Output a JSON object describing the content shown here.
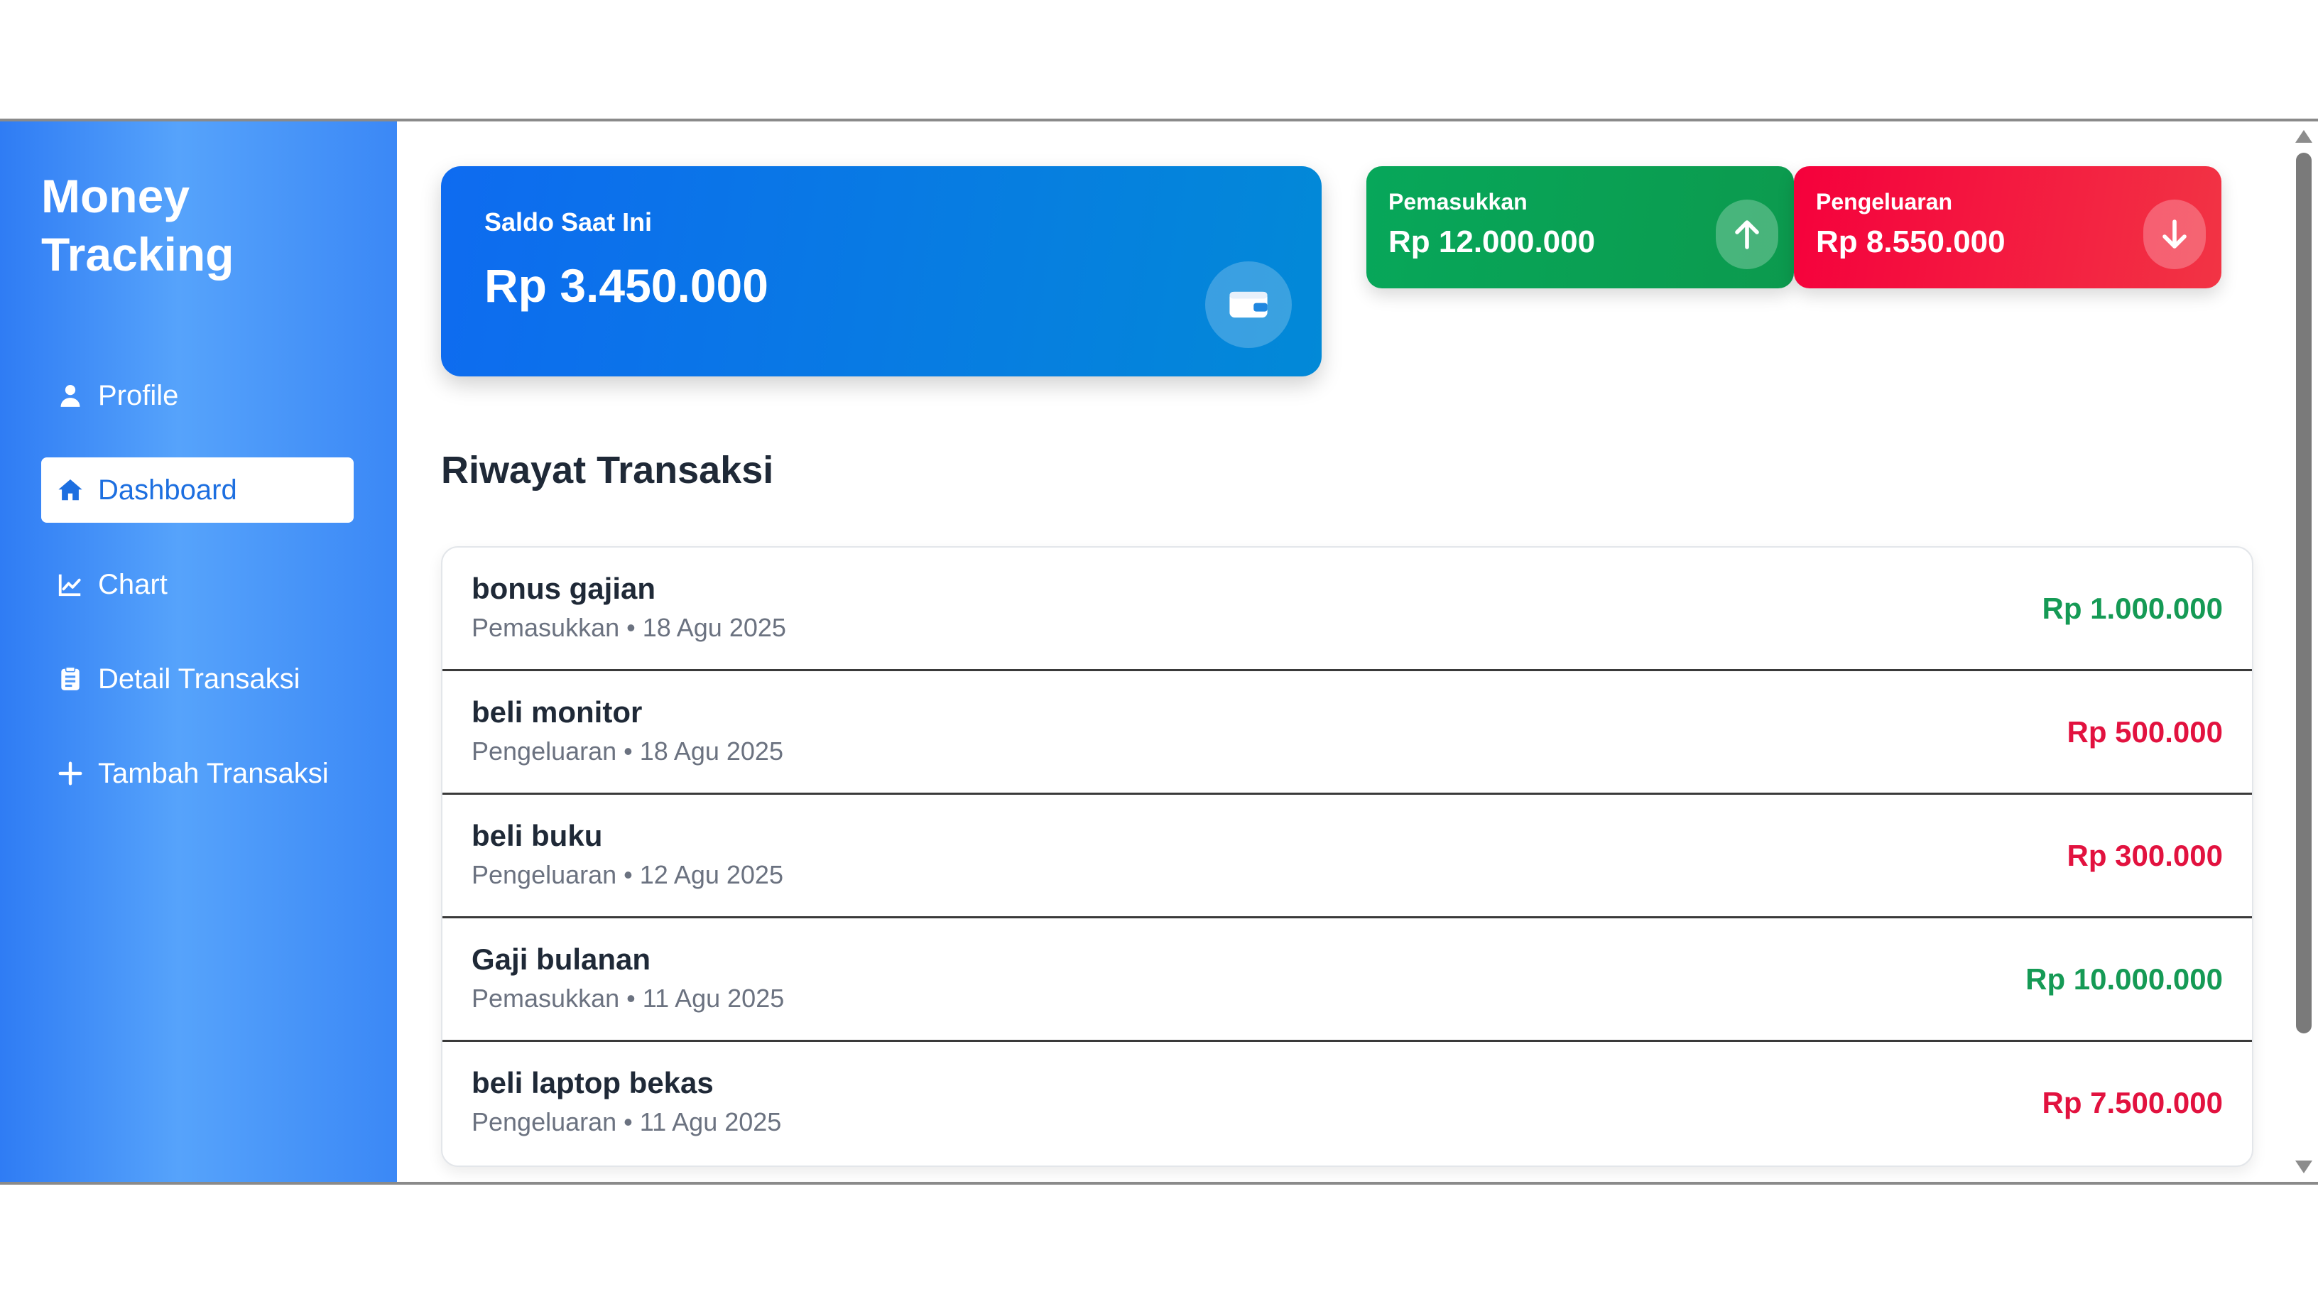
{
  "app": {
    "title_line1": "Money",
    "title_line2": "Tracking"
  },
  "sidebar": {
    "items": [
      {
        "label": "Profile",
        "icon": "user-icon",
        "active": false
      },
      {
        "label": "Dashboard",
        "icon": "home-icon",
        "active": true
      },
      {
        "label": "Chart",
        "icon": "chart-line-icon",
        "active": false
      },
      {
        "label": "Detail Transaksi",
        "icon": "clipboard-icon",
        "active": false
      },
      {
        "label": "Tambah Transaksi",
        "icon": "plus-icon",
        "active": false
      }
    ]
  },
  "summary": {
    "balance": {
      "label": "Saldo Saat Ini",
      "value": "Rp 3.450.000",
      "icon": "wallet-icon"
    },
    "income": {
      "label": "Pemasukkan",
      "value": "Rp 12.000.000",
      "icon": "arrow-up-icon",
      "color": "#07a75a"
    },
    "expense": {
      "label": "Pengeluaran",
      "value": "Rp 8.550.000",
      "icon": "arrow-down-icon",
      "color": "#f5003c"
    }
  },
  "transactions": {
    "title": "Riwayat Transaksi",
    "rows": [
      {
        "title": "bonus gajian",
        "meta": "Pemasukkan • 18 Agu 2025",
        "amount": "Rp 1.000.000",
        "type": "in"
      },
      {
        "title": "beli monitor",
        "meta": "Pengeluaran • 18 Agu 2025",
        "amount": "Rp 500.000",
        "type": "out"
      },
      {
        "title": "beli buku",
        "meta": "Pengeluaran • 12 Agu 2025",
        "amount": "Rp 300.000",
        "type": "out"
      },
      {
        "title": "Gaji bulanan",
        "meta": "Pemasukkan • 11 Agu 2025",
        "amount": "Rp 10.000.000",
        "type": "in"
      },
      {
        "title": "beli laptop bekas",
        "meta": "Pengeluaran • 11 Agu 2025",
        "amount": "Rp 7.500.000",
        "type": "out"
      }
    ]
  },
  "colors": {
    "income_text": "#159a55",
    "expense_text": "#e2123f",
    "sidebar": "#3b88f6"
  }
}
